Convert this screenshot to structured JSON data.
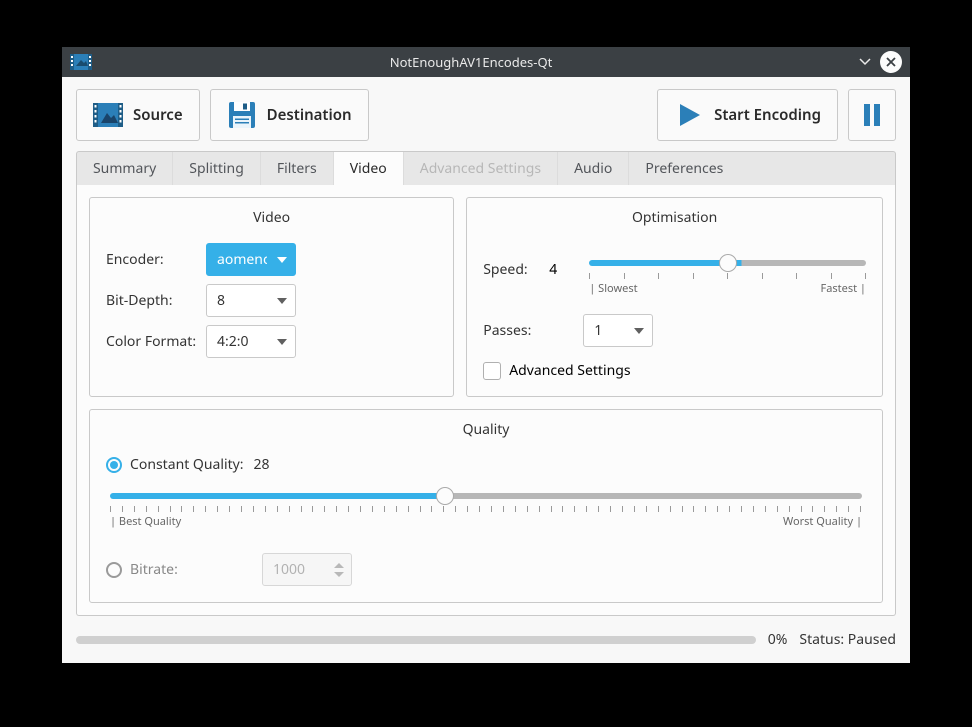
{
  "colors": {
    "accent": "#35b0e8"
  },
  "window": {
    "title": "NotEnoughAV1Encodes-Qt"
  },
  "toolbar": {
    "source": "Source",
    "destination": "Destination",
    "start": "Start Encoding"
  },
  "tabs": [
    {
      "label": "Summary",
      "active": false
    },
    {
      "label": "Splitting",
      "active": false
    },
    {
      "label": "Filters",
      "active": false
    },
    {
      "label": "Video",
      "active": true
    },
    {
      "label": "Advanced Settings",
      "active": false,
      "disabled": true
    },
    {
      "label": "Audio",
      "active": false
    },
    {
      "label": "Preferences",
      "active": false
    }
  ],
  "video": {
    "title": "Video",
    "encoder": {
      "label": "Encoder:",
      "value": "aomenc"
    },
    "bitdepth": {
      "label": "Bit-Depth:",
      "value": "8"
    },
    "colorformat": {
      "label": "Color Format:",
      "value": "4:2:0"
    }
  },
  "optimisation": {
    "title": "Optimisation",
    "speed": {
      "label": "Speed:",
      "value": "4",
      "min": 0,
      "max": 8,
      "pct": "55%"
    },
    "slowest": "| Slowest",
    "fastest": "Fastest |",
    "passes": {
      "label": "Passes:",
      "value": "1"
    },
    "advanced": {
      "label": "Advanced Settings",
      "checked": false
    }
  },
  "quality": {
    "title": "Quality",
    "constant": {
      "label": "Constant Quality:",
      "value": "28",
      "min": 0,
      "max": 63,
      "pct": "44.4%",
      "checked": true
    },
    "best": "| Best Quality",
    "worst": "Worst Quality |",
    "bitrate": {
      "label": "Bitrate:",
      "value": "1000",
      "checked": false
    }
  },
  "status": {
    "percent": "0%",
    "label": "Status: Paused",
    "pct_num": 0
  }
}
